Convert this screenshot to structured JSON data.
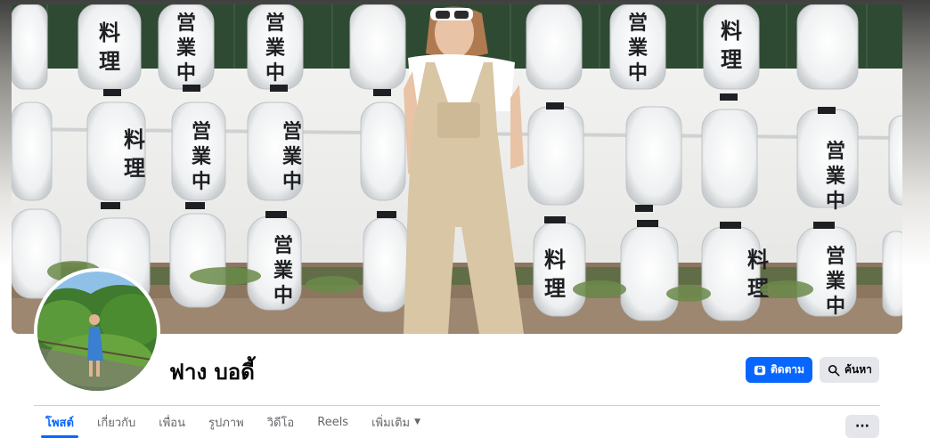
{
  "profile": {
    "name": "ฟาง บอดี้"
  },
  "actions": {
    "follow_label": "ติดตาม",
    "search_label": "ค้นหา"
  },
  "tabs": [
    {
      "label": "โพสต์",
      "active": true
    },
    {
      "label": "เกี่ยวกับ"
    },
    {
      "label": "เพื่อน"
    },
    {
      "label": "รูปภาพ"
    },
    {
      "label": "วิดีโอ"
    },
    {
      "label": "Reels"
    },
    {
      "label": "เพิ่มเติม",
      "dropdown": true
    }
  ],
  "more_button": {
    "label": "···"
  },
  "cover": {
    "lantern_text": [
      "営",
      "業",
      "中",
      "料",
      "理"
    ]
  },
  "colors": {
    "accent": "#0866ff",
    "secondary_button": "#e4e6eb",
    "text_primary": "#050505",
    "text_secondary": "#65676b"
  },
  "icons": {
    "follow": "follow-icon",
    "search": "search-icon",
    "dropdown": "caret-down-icon",
    "more": "more-dots-icon"
  }
}
